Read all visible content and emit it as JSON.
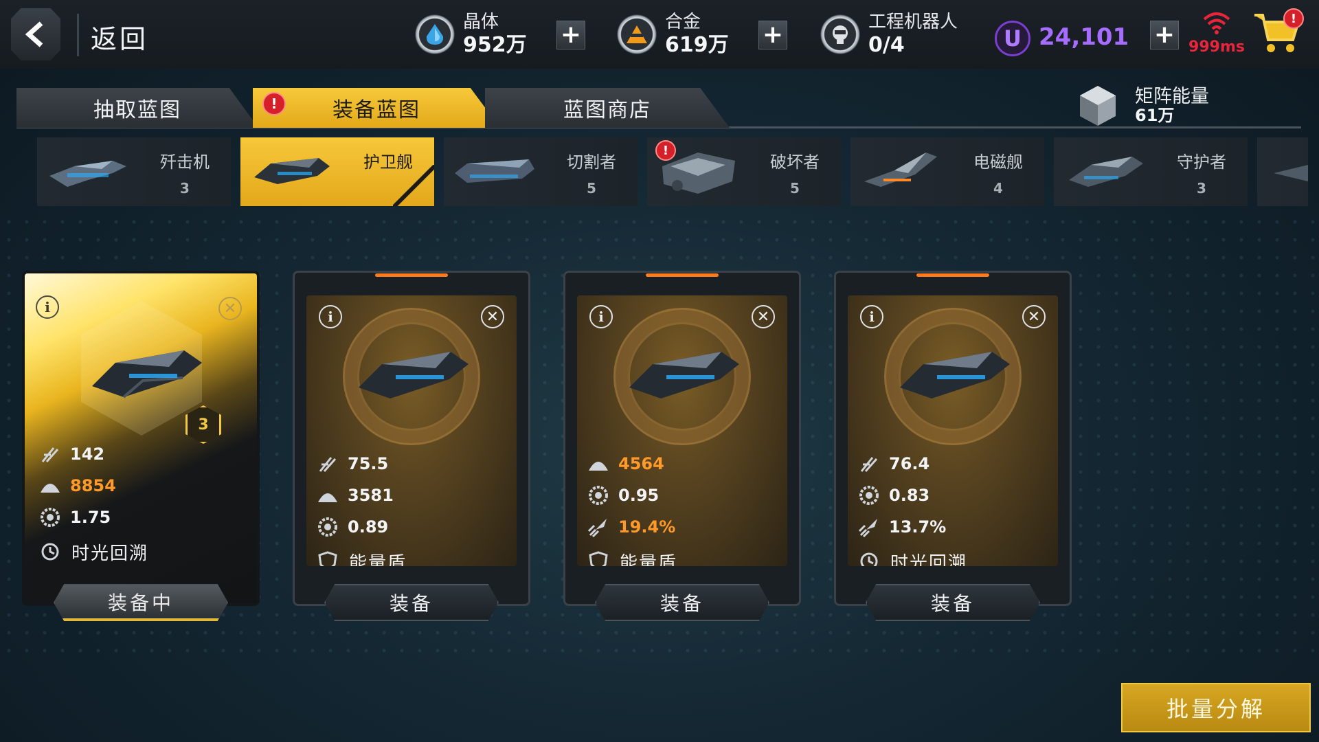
{
  "header": {
    "back_label": "返回",
    "crystal": {
      "name": "晶体",
      "value": "952万"
    },
    "alloy": {
      "name": "合金",
      "value": "619万"
    },
    "robot": {
      "name": "工程机器人",
      "value": "0/4"
    },
    "u_currency": {
      "symbol": "U",
      "value": "24,101"
    },
    "ping": "999ms",
    "cart_badge": "!"
  },
  "tabs": [
    {
      "label": "抽取蓝图",
      "active": false
    },
    {
      "label": "装备蓝图",
      "active": true,
      "badge": "!"
    },
    {
      "label": "蓝图商店",
      "active": false
    }
  ],
  "matrix_energy": {
    "name": "矩阵能量",
    "value": "61万"
  },
  "ship_types": [
    {
      "name": "歼击机",
      "count": "3"
    },
    {
      "name": "护卫舰",
      "count": "",
      "active": true
    },
    {
      "name": "切割者",
      "count": "5"
    },
    {
      "name": "破坏者",
      "count": "5",
      "badge": "!"
    },
    {
      "name": "电磁舰",
      "count": "4"
    },
    {
      "name": "守护者",
      "count": "3"
    }
  ],
  "cards": [
    {
      "equipped": true,
      "level": "3",
      "stats": [
        "142",
        "8854",
        "1.75"
      ],
      "highlight": [
        false,
        true,
        false
      ],
      "skill": "时光回溯",
      "button": "装备中"
    },
    {
      "equipped": false,
      "stats": [
        "75.5",
        "3581",
        "0.89"
      ],
      "highlight": [
        false,
        false,
        false
      ],
      "skill": "能量盾",
      "button": "装备"
    },
    {
      "equipped": false,
      "stats": [
        "4564",
        "0.95",
        "19.4%"
      ],
      "highlight": [
        true,
        false,
        true
      ],
      "skill": "能量盾",
      "button": "装备"
    },
    {
      "equipped": false,
      "stats": [
        "76.4",
        "0.83",
        "13.7%"
      ],
      "highlight": [
        false,
        false,
        false
      ],
      "skill": "时光回溯",
      "button": "装备"
    }
  ],
  "batch_button": "批量分解",
  "colors": {
    "gold": "#e3a91a",
    "orange_highlight": "#ff9a2a",
    "purple": "#a56cff",
    "ping_red": "#e8253a"
  }
}
